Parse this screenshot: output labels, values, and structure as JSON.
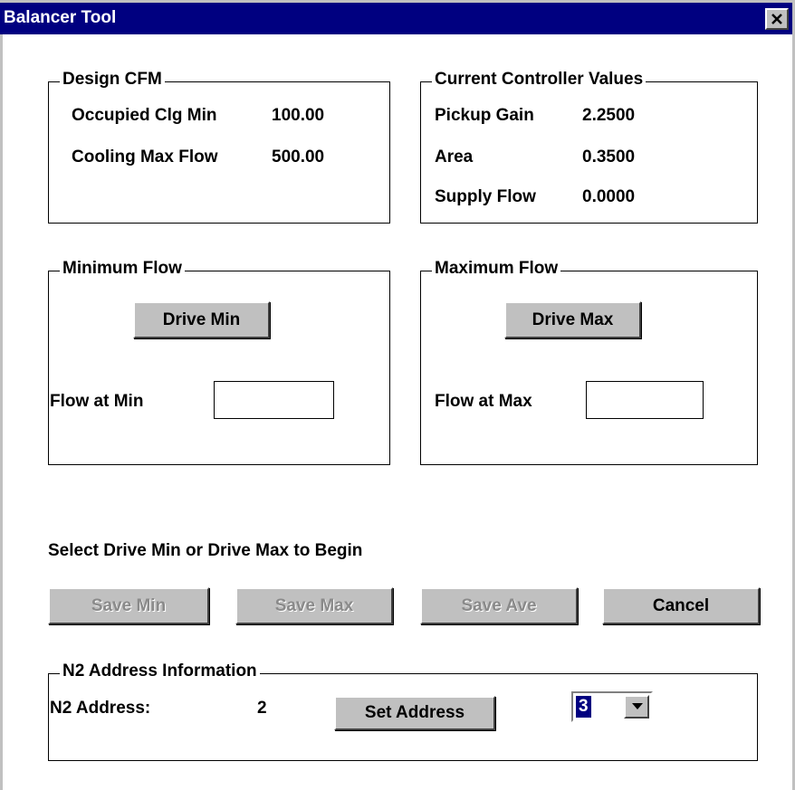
{
  "window": {
    "title": "Balancer Tool"
  },
  "design_cfm": {
    "legend": "Design CFM",
    "rows": [
      {
        "label": "Occupied Clg Min",
        "value": "100.00"
      },
      {
        "label": "Cooling Max Flow",
        "value": "500.00"
      }
    ]
  },
  "controller": {
    "legend": "Current Controller Values",
    "rows": [
      {
        "label": "Pickup Gain",
        "value": "2.2500"
      },
      {
        "label": "Area",
        "value": "0.3500"
      },
      {
        "label": "Supply Flow",
        "value": "0.0000"
      }
    ]
  },
  "min_flow": {
    "legend": "Minimum Flow",
    "button": "Drive Min",
    "field_label": "Flow at Min",
    "field_value": ""
  },
  "max_flow": {
    "legend": "Maximum Flow",
    "button": "Drive Max",
    "field_label": "Flow at Max",
    "field_value": ""
  },
  "instruction": "Select Drive Min or Drive Max to Begin",
  "actions": {
    "save_min": "Save Min",
    "save_max": "Save Max",
    "save_ave": "Save Ave",
    "cancel": "Cancel"
  },
  "n2": {
    "legend": "N2 Address Information",
    "address_label": "N2 Address:",
    "address_value": "2",
    "set_button": "Set Address",
    "select_value": "3"
  },
  "icons": {
    "close": "close-icon",
    "dropdown": "chevron-down-icon"
  },
  "colors": {
    "titlebar": "#000080",
    "face": "#c0c0c0",
    "disabled_text": "#8a8a8a"
  }
}
